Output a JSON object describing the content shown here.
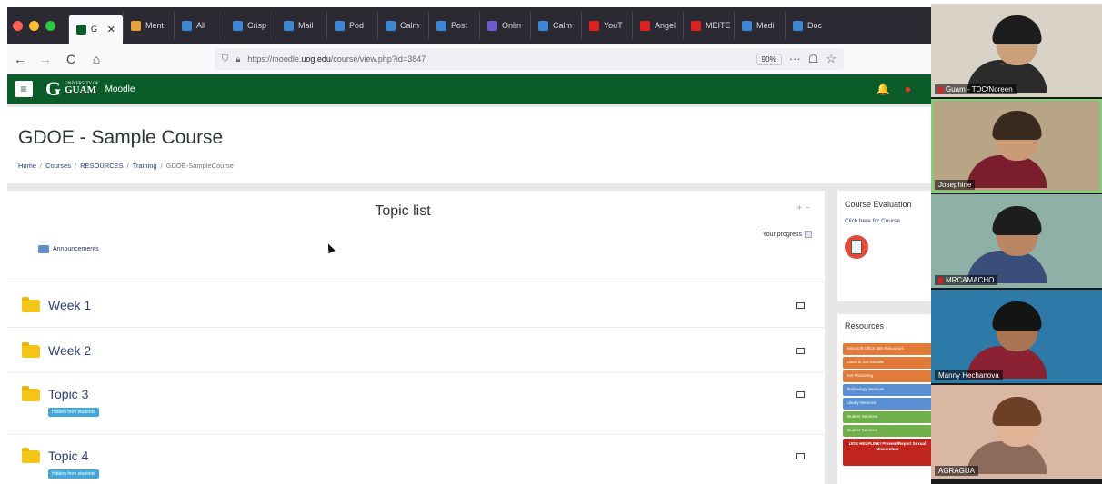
{
  "colors": {
    "moodle_green": "#0c5c2a",
    "link_blue": "#2c3f78",
    "folder_yellow": "#f5c518",
    "hidden_badge": "#41a8dc"
  },
  "browser": {
    "tabs": [
      {
        "label": "G",
        "fav": "#0c5c2a",
        "active": true,
        "close": "✕"
      },
      {
        "label": "Ment",
        "fav": "#e8a23a"
      },
      {
        "label": "All",
        "fav": "#3c86d6"
      },
      {
        "label": "Crisp",
        "fav": "#3c86d6"
      },
      {
        "label": "Mail",
        "fav": "#3c86d6"
      },
      {
        "label": "Pod",
        "fav": "#3c86d6"
      },
      {
        "label": "Calm",
        "fav": "#3c86d6"
      },
      {
        "label": "Post",
        "fav": "#3c86d6"
      },
      {
        "label": "Onlin",
        "fav": "#6a5acd"
      },
      {
        "label": "Calm",
        "fav": "#3c86d6"
      },
      {
        "label": "YouT",
        "fav": "#e02020"
      },
      {
        "label": "Angel",
        "fav": "#e02020"
      },
      {
        "label": "MEITE",
        "fav": "#e02020"
      },
      {
        "label": "Medi",
        "fav": "#3c86d6"
      },
      {
        "label": "Doc",
        "fav": "#3c86d6"
      }
    ],
    "nav": {
      "back": "←",
      "forward": "→",
      "reload": "C",
      "home": "⌂"
    },
    "url": {
      "prefix": "https://moodle.",
      "domain": "uog.edu",
      "path": "/course/view.php?id=3847",
      "zoom": "90%",
      "icons": [
        "···",
        "☖",
        "☆"
      ]
    }
  },
  "moodle": {
    "menu_icon": "≡",
    "logo": {
      "g": "G",
      "university_of": "UNIVERSITY OF",
      "guam": "GUAM",
      "moodle": "Moodle"
    },
    "right_icons": [
      "🔔",
      "●"
    ]
  },
  "course": {
    "title": "GDOE - Sample Course",
    "breadcrumb": [
      "Home",
      "Courses",
      "RESOURCES",
      "Training",
      "GDOE-SampleCourse"
    ],
    "breadcrumb_sep": "/",
    "topic_list": "Topic list",
    "controls": "+ −",
    "your_progress": "Your progress",
    "announcements": "Announcements",
    "sections": [
      {
        "name": "Week 1",
        "badge": ""
      },
      {
        "name": "Week 2",
        "badge": ""
      },
      {
        "name": "Topic 3",
        "badge": "Hidden from students"
      },
      {
        "name": "Topic 4",
        "badge": "Hidden from students"
      }
    ]
  },
  "sidebar": {
    "course_evaluation": {
      "title": "Course Evaluation",
      "link": "Click here for Course"
    },
    "resources": {
      "title": "Resources",
      "buttons": [
        {
          "label": "Microsoft Office 365 Resources",
          "color": "#e07b39"
        },
        {
          "label": "Learn to use Moodle",
          "color": "#e07b39"
        },
        {
          "label": "Get Proctoring",
          "color": "#e07b39"
        },
        {
          "label": "Technology Services",
          "color": "#5b8fd3"
        },
        {
          "label": "Library Services",
          "color": "#5b8fd3"
        },
        {
          "label": "Student Services",
          "color": "#6fb04a"
        },
        {
          "label": "Student Services",
          "color": "#6fb04a"
        },
        {
          "label": "UOG HELPLINE! Prevent/Report Sexual Misconduct",
          "color": "#c0241e"
        }
      ]
    }
  },
  "participants": [
    {
      "name": "Guam - TDC/Noreen",
      "bg": "#d9d3c7",
      "skin": "#caa07a",
      "hair": "#1c1c1c",
      "shirt": "#2b2b2b"
    },
    {
      "name": "Josephine",
      "bg": "#b8a585",
      "skin": "#c99a74",
      "hair": "#3a2a1e",
      "shirt": "#7a1e2e"
    },
    {
      "name": "MRCAMACHO",
      "bg": "#8fb0a6",
      "skin": "#b98563",
      "hair": "#1d1d1d",
      "shirt": "#3a4e7a"
    },
    {
      "name": "Manny Hechanova",
      "bg": "#2d79a8",
      "skin": "#a97555",
      "hair": "#141414",
      "shirt": "#8a2233"
    },
    {
      "name": "AGRAGUA",
      "bg": "#d9b7a3",
      "skin": "#e1b497",
      "hair": "#6b4026",
      "shirt": "#8c6a5c"
    }
  ]
}
